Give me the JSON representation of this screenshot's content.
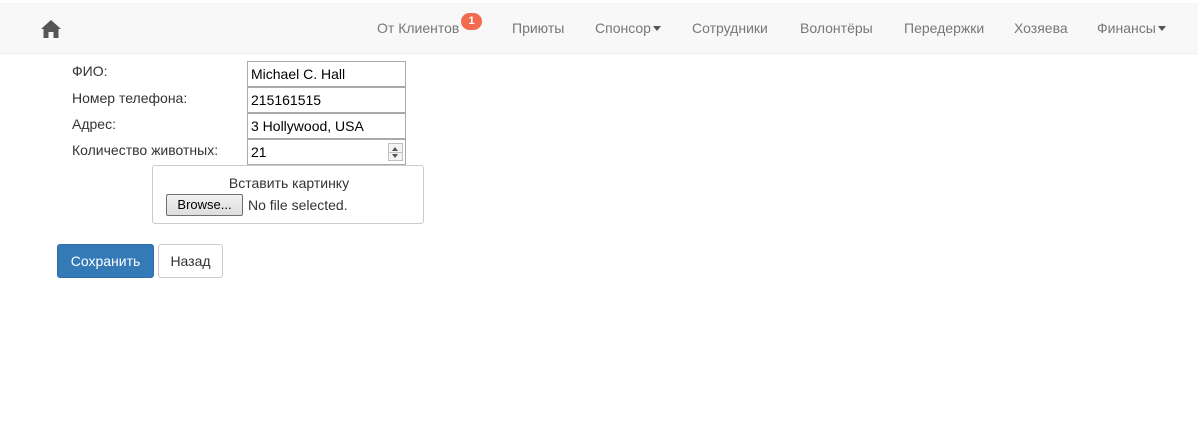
{
  "nav": {
    "items": [
      {
        "label": "От Клиентов",
        "badge": "1"
      },
      {
        "label": "Приюты"
      },
      {
        "label": "Спонсор"
      },
      {
        "label": "Сотрудники"
      },
      {
        "label": "Волонтёры"
      },
      {
        "label": "Передержки"
      },
      {
        "label": "Хозяева"
      },
      {
        "label": "Финансы"
      }
    ]
  },
  "form": {
    "fio_label": "ФИО:",
    "fio_value": "Michael C. Hall",
    "phone_label": "Номер телефона:",
    "phone_value": "215161515",
    "address_label": "Адрес:",
    "address_value": "3 Hollywood, USA",
    "animals_label": "Количество животных:",
    "animals_value": "21",
    "image_title": "Вставить картинку",
    "browse_label": "Browse...",
    "no_file": "No file selected."
  },
  "actions": {
    "save_label": "Сохранить",
    "back_label": "Назад"
  },
  "colors": {
    "primary": "#337ab7",
    "badge": "#f26b4f",
    "navbar_bg": "#f8f8f8"
  },
  "icons": {
    "home": "home-icon"
  }
}
